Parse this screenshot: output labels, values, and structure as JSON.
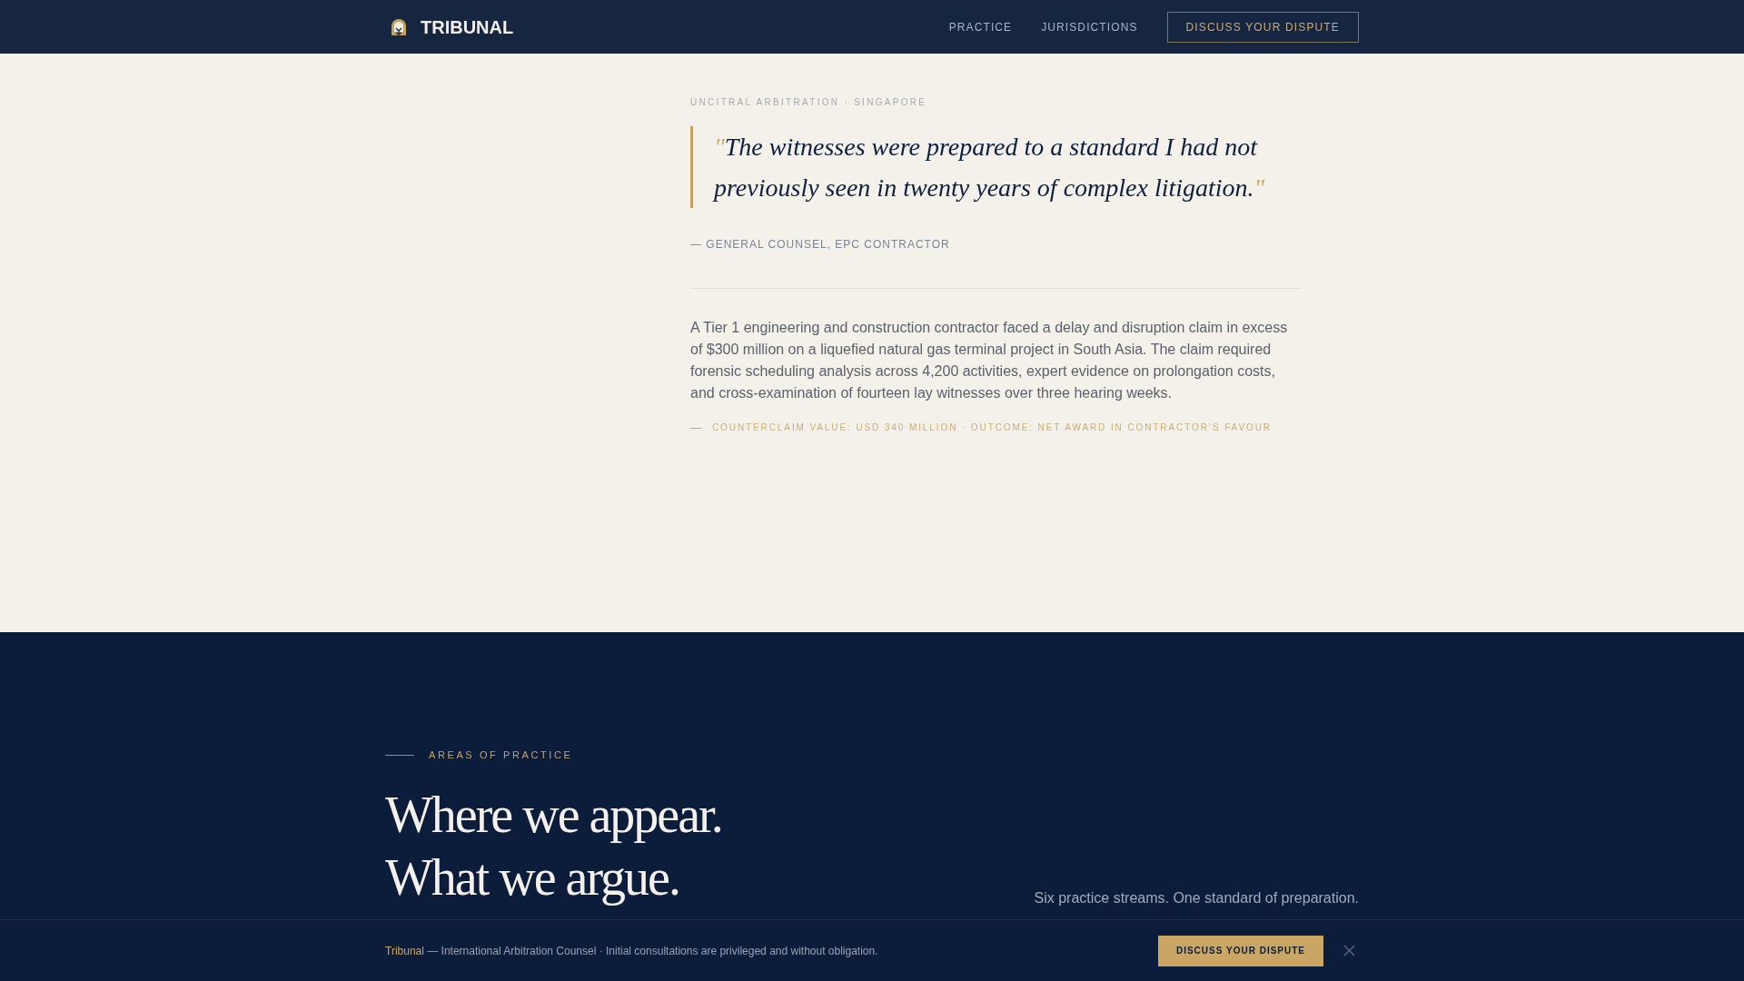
{
  "header": {
    "brand": "TRIBUNAL",
    "nav": [
      {
        "label": "PRACTICE"
      },
      {
        "label": "JURISDICTIONS"
      }
    ],
    "cta": "DISCUSS YOUR DISPUTE"
  },
  "case_study": {
    "eyebrow": "UNCITRAL ARBITRATION · SINGAPORE",
    "quote": {
      "open_mark": "\"",
      "text": "The witnesses were prepared to a standard I had not previously seen in twenty years of complex litigation.",
      "close_mark": "\""
    },
    "attribution": "— GENERAL COUNSEL, EPC CONTRACTOR",
    "summary": "A Tier 1 engineering and construction contractor faced a delay and disruption claim in excess of $300 million on a liquefied natural gas terminal project in South Asia. The claim required forensic scheduling analysis across 4,200 activities, expert evidence on prolongation costs, and cross-examination of fourteen lay witnesses over three hearing weeks.",
    "outcome": "COUNTERCLAIM VALUE: USD 340 MILLION · OUTCOME: NET AWARD IN CONTRACTOR’S FAVOUR"
  },
  "practice": {
    "eyebrow": "AREAS OF PRACTICE",
    "heading": [
      "Where we appear.",
      "What we argue."
    ],
    "intro": "Six practice streams. One standard of preparation."
  },
  "notice_bar": {
    "brand": "Tribunal",
    "text": "— International Arbitration Counsel · Initial consultations are privileged and without obligation.",
    "cta": "DISCUSS YOUR DISPUTE"
  }
}
